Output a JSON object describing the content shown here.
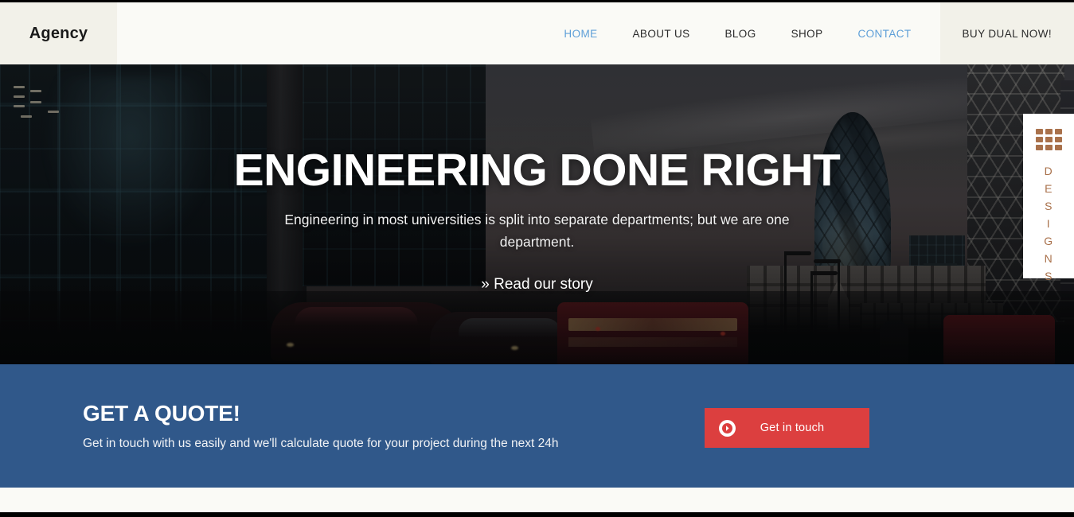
{
  "site": {
    "logo": "Agency"
  },
  "nav": {
    "items": [
      {
        "label": "HOME",
        "state": "active"
      },
      {
        "label": "ABOUT US",
        "state": "default"
      },
      {
        "label": "BLOG",
        "state": "default"
      },
      {
        "label": "SHOP",
        "state": "default"
      },
      {
        "label": "CONTACT",
        "state": "active"
      },
      {
        "label": "BUY DUAL NOW!",
        "state": "cta"
      }
    ],
    "active_color": "#5e9fd8",
    "default_color": "#2b2b2b"
  },
  "hero": {
    "title": "ENGINEERING DONE RIGHT",
    "subtitle": "Engineering in most universities is split into separate departments; but we are one department.",
    "link": "» Read our story"
  },
  "designs_tab": {
    "icon": "grid-3x3-icon",
    "label": "DESIGNS",
    "letters": [
      "D",
      "E",
      "S",
      "I",
      "G",
      "N",
      "S"
    ],
    "color": "#a9714b"
  },
  "quote": {
    "title": "GET A QUOTE!",
    "subtitle": "Get in touch with us easily and we'll calculate quote for your project during the next 24h",
    "button_label": "Get in touch",
    "button_icon": "arrow-right-circle-icon",
    "band_color": "#30588a",
    "button_color": "#dc3f3f"
  }
}
